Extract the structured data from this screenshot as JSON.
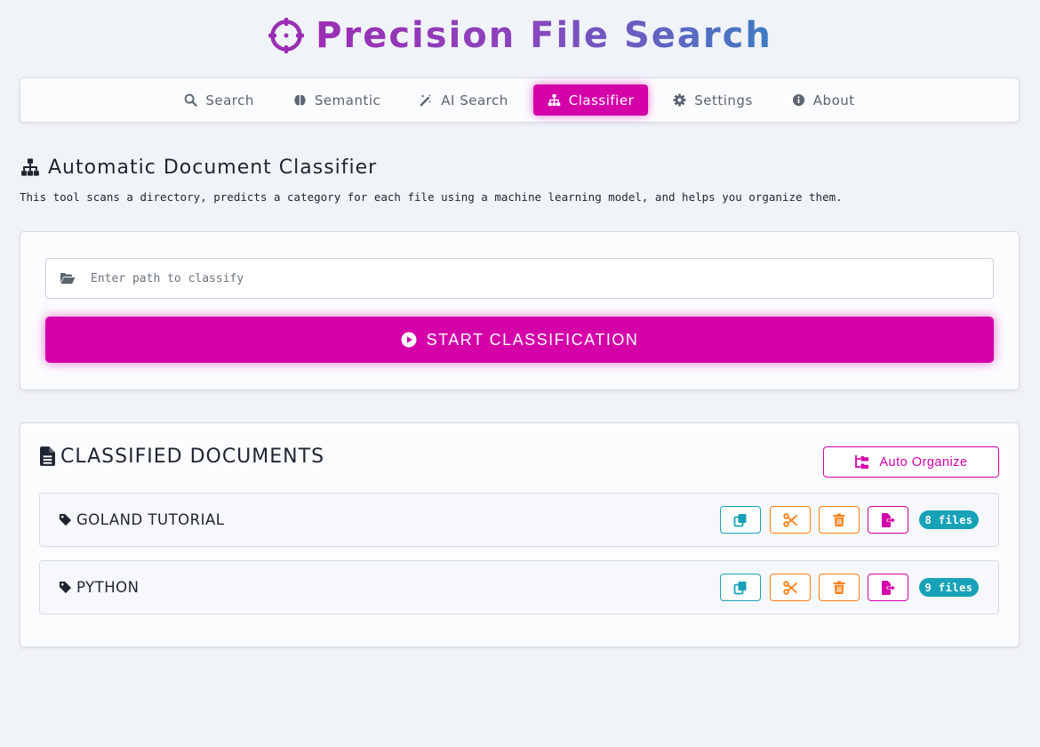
{
  "app": {
    "title": "Precision File Search",
    "icon": "crosshair-icon",
    "gradient": [
      "#9a2fb3",
      "#3f7cc4"
    ]
  },
  "nav": {
    "items": [
      {
        "label": "Search",
        "icon": "search-icon"
      },
      {
        "label": "Semantic",
        "icon": "brain-icon"
      },
      {
        "label": "AI Search",
        "icon": "magic-wand-icon"
      },
      {
        "label": "Classifier",
        "icon": "sitemap-icon",
        "active": true
      },
      {
        "label": "Settings",
        "icon": "gear-icon"
      },
      {
        "label": "About",
        "icon": "info-icon"
      }
    ]
  },
  "classifier": {
    "title": "Automatic Document Classifier",
    "description": "This tool scans a directory, predicts a category for each file using a machine learning model, and helps you organize them.",
    "path_placeholder": "Enter path to classify",
    "path_value": "",
    "start_label": "START CLASSIFICATION"
  },
  "results": {
    "title": "CLASSIFIED DOCUMENTS",
    "auto_organize_label": "Auto Organize",
    "categories": [
      {
        "name": "GOLAND TUTORIAL",
        "count_label": "8 files"
      },
      {
        "name": "PYTHON",
        "count_label": "9 files"
      }
    ]
  },
  "colors": {
    "accent": "#d400a8",
    "info": "#17a2b8",
    "warning": "#fd7e14",
    "background": "#f0f3f8"
  }
}
